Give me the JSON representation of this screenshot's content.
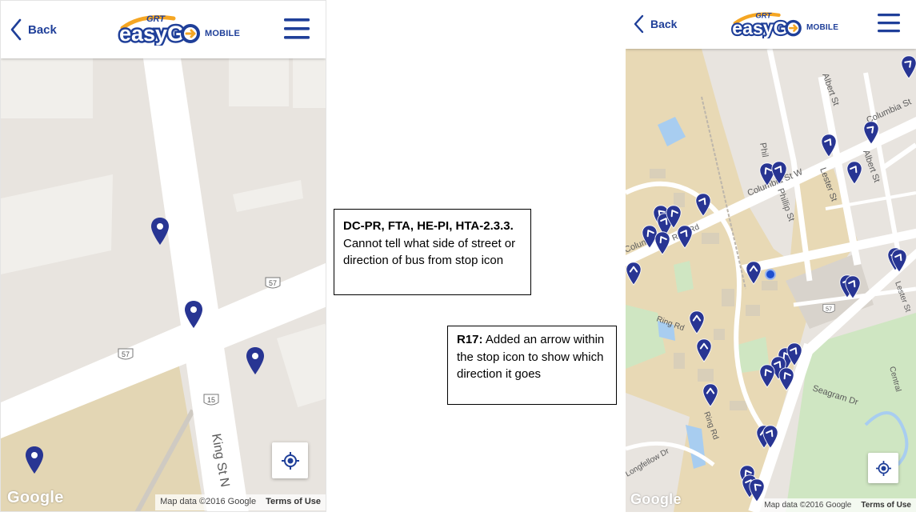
{
  "left_screen": {
    "header": {
      "back_label": "Back",
      "logo_top": "GRT",
      "logo_main": "easyG",
      "logo_small": "MOBILE"
    },
    "map": {
      "street_king": "King St N",
      "route_shields": [
        "57",
        "57",
        "15"
      ],
      "google_logo": "Google",
      "attribution": "Map data ©2016 Google",
      "terms": "Terms of Use"
    },
    "stop_icon": "plain-map-pin-icon"
  },
  "right_screen": {
    "header": {
      "back_label": "Back",
      "logo_top": "GRT",
      "logo_main": "easyG",
      "logo_small": "MOBILE"
    },
    "map": {
      "streets": [
        "Albert St",
        "Columbia St",
        "Columbia St W",
        "Phillip St",
        "Phil",
        "Lester St",
        "Ring Rd",
        "Ring Rd",
        "Ring Rd",
        "Columb",
        "Seagram Dr",
        "Central",
        "Longfellow Dr",
        "Albert St",
        "A",
        "Lester St"
      ],
      "route_shields": [
        "57"
      ],
      "google_logo": "Google",
      "attribution": "Map data ©2016 Google",
      "terms": "Terms of Use"
    },
    "stop_icon": "arrow-map-pin-icon"
  },
  "callouts": [
    {
      "bold": "DC-PR, FTA, HE-PI, HTA-2.3.3.",
      "text": " Cannot tell what side of street or direction of bus from stop icon"
    },
    {
      "bold": "R17:",
      "text": " Added an arrow within the stop icon to show which direction it goes"
    }
  ],
  "colors": {
    "brand_blue": "#1f3f99",
    "pin_blue": "#283593",
    "logo_orange": "#f5a623",
    "map_bg": "#e8e4df",
    "campus_tan": "#e8d9b5",
    "park_green": "#cfe6c2",
    "water_blue": "#a8cdf0"
  }
}
